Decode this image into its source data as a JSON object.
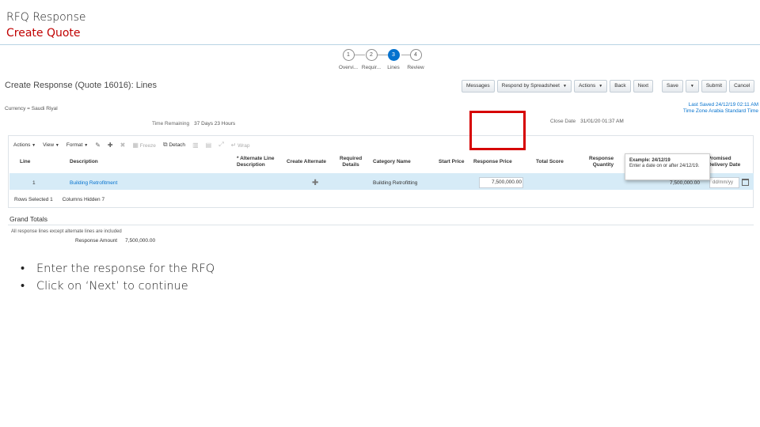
{
  "slide": {
    "title": "RFQ Response",
    "subtitle": "Create Quote",
    "bullets": [
      "Enter the response for the RFQ",
      "Click on ‘Next’ to continue"
    ]
  },
  "train": [
    {
      "num": "1",
      "label": "Overvi...",
      "current": false
    },
    {
      "num": "2",
      "label": "Requir...",
      "current": false
    },
    {
      "num": "3",
      "label": "Lines",
      "current": true
    },
    {
      "num": "4",
      "label": "Review",
      "current": false
    }
  ],
  "page": {
    "heading": "Create Response (Quote 16016): Lines",
    "currency": "Currency = Saudi Riyal",
    "last_saved": "Last Saved 24/12/19 02:11 AM",
    "time_zone": "Time Zone Arabia Standard Time",
    "time_remaining_label": "Time Remaining",
    "time_remaining_value": "37 Days 23 Hours",
    "close_date_label": "Close Date",
    "close_date_value": "31/01/20 01:37 AM"
  },
  "toolbar": {
    "messages": "Messages",
    "respond_by_spreadsheet": "Respond by Spreadsheet",
    "actions": "Actions",
    "back": "Back",
    "next": "Next",
    "save": "Save",
    "submit": "Submit",
    "cancel": "Cancel"
  },
  "table_tools": {
    "actions": "Actions",
    "view": "View",
    "format": "Format",
    "freeze": "Freeze",
    "detach": "Detach",
    "wrap": "Wrap"
  },
  "columns": {
    "line": "Line",
    "description": "Description",
    "alternate_line_1": "* Alternate Line",
    "alternate_line_2": "Description",
    "create_alternate": "Create Alternate",
    "required_1": "Required",
    "required_2": "Details",
    "category_name": "Category Name",
    "start_price": "Start Price",
    "response_price": "Response Price",
    "total_score": "Total Score",
    "response_qty_1": "Response",
    "response_qty_2": "Quantity",
    "promised_1": "Promised",
    "promised_2": "Delivery Date"
  },
  "row": {
    "line": "1",
    "description": "Building Retrofitment",
    "category": "Building Retrofitting",
    "response_price": "7,500,000.00",
    "amount_partial": "7,500,000.00",
    "date_placeholder": "dd/mm/yy"
  },
  "tooltip": {
    "title": "Example: 24/12/19",
    "body": "Enter a date on or after 24/12/19."
  },
  "summary": {
    "rows_selected": "Rows Selected  1",
    "columns_hidden": "Columns Hidden  7",
    "grand_totals": "Grand Totals",
    "note": "All response lines except alternate lines are included",
    "response_amount_label": "Response Amount",
    "response_amount_value": "7,500,000.00"
  }
}
